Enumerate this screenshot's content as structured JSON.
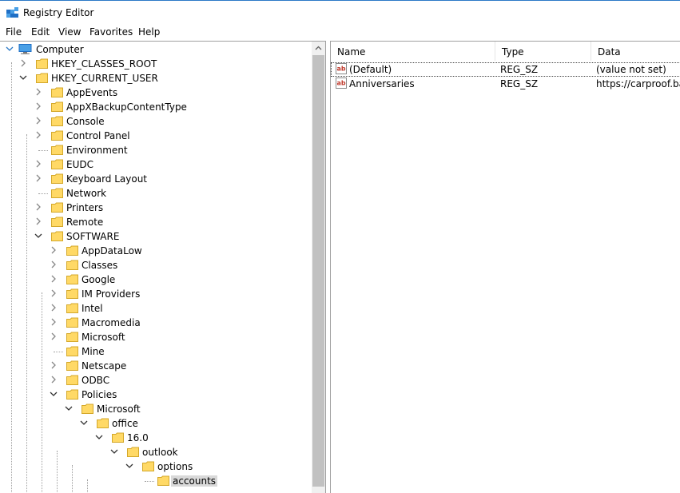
{
  "window": {
    "title": "Registry Editor"
  },
  "menu": [
    "File",
    "Edit",
    "View",
    "Favorites",
    "Help"
  ],
  "tree": {
    "root": "Computer",
    "nodes": [
      {
        "label": "HKEY_CLASSES_ROOT",
        "level": 1,
        "state": "collapsed"
      },
      {
        "label": "HKEY_CURRENT_USER",
        "level": 1,
        "state": "expanded"
      },
      {
        "label": "AppEvents",
        "level": 2,
        "state": "collapsed"
      },
      {
        "label": "AppXBackupContentType",
        "level": 2,
        "state": "collapsed"
      },
      {
        "label": "Console",
        "level": 2,
        "state": "collapsed"
      },
      {
        "label": "Control Panel",
        "level": 2,
        "state": "collapsed"
      },
      {
        "label": "Environment",
        "level": 2,
        "state": "leaf"
      },
      {
        "label": "EUDC",
        "level": 2,
        "state": "collapsed"
      },
      {
        "label": "Keyboard Layout",
        "level": 2,
        "state": "collapsed"
      },
      {
        "label": "Network",
        "level": 2,
        "state": "leaf"
      },
      {
        "label": "Printers",
        "level": 2,
        "state": "collapsed"
      },
      {
        "label": "Remote",
        "level": 2,
        "state": "collapsed"
      },
      {
        "label": "SOFTWARE",
        "level": 2,
        "state": "expanded"
      },
      {
        "label": "AppDataLow",
        "level": 3,
        "state": "collapsed"
      },
      {
        "label": "Classes",
        "level": 3,
        "state": "collapsed"
      },
      {
        "label": "Google",
        "level": 3,
        "state": "collapsed"
      },
      {
        "label": "IM Providers",
        "level": 3,
        "state": "collapsed"
      },
      {
        "label": "Intel",
        "level": 3,
        "state": "collapsed"
      },
      {
        "label": "Macromedia",
        "level": 3,
        "state": "collapsed"
      },
      {
        "label": "Microsoft",
        "level": 3,
        "state": "collapsed"
      },
      {
        "label": "Mine",
        "level": 3,
        "state": "leaf"
      },
      {
        "label": "Netscape",
        "level": 3,
        "state": "collapsed"
      },
      {
        "label": "ODBC",
        "level": 3,
        "state": "collapsed"
      },
      {
        "label": "Policies",
        "level": 3,
        "state": "expanded"
      },
      {
        "label": "Microsoft",
        "level": 4,
        "state": "expanded"
      },
      {
        "label": "office",
        "level": 5,
        "state": "expanded"
      },
      {
        "label": "16.0",
        "level": 6,
        "state": "expanded"
      },
      {
        "label": "outlook",
        "level": 7,
        "state": "expanded"
      },
      {
        "label": "options",
        "level": 8,
        "state": "expanded"
      },
      {
        "label": "accounts",
        "level": 9,
        "state": "leaf",
        "selected": true
      }
    ]
  },
  "list": {
    "columns": [
      "Name",
      "Type",
      "Data"
    ],
    "rows": [
      {
        "name": "(Default)",
        "type": "REG_SZ",
        "data": "(value not set)"
      },
      {
        "name": "Anniversaries",
        "type": "REG_SZ",
        "data": "https://carproof.bar"
      }
    ]
  },
  "colors": {
    "selection": "#d9d9d9",
    "folder": "#ffd966",
    "accent": "#2b79c7",
    "chevron": "#666666"
  }
}
